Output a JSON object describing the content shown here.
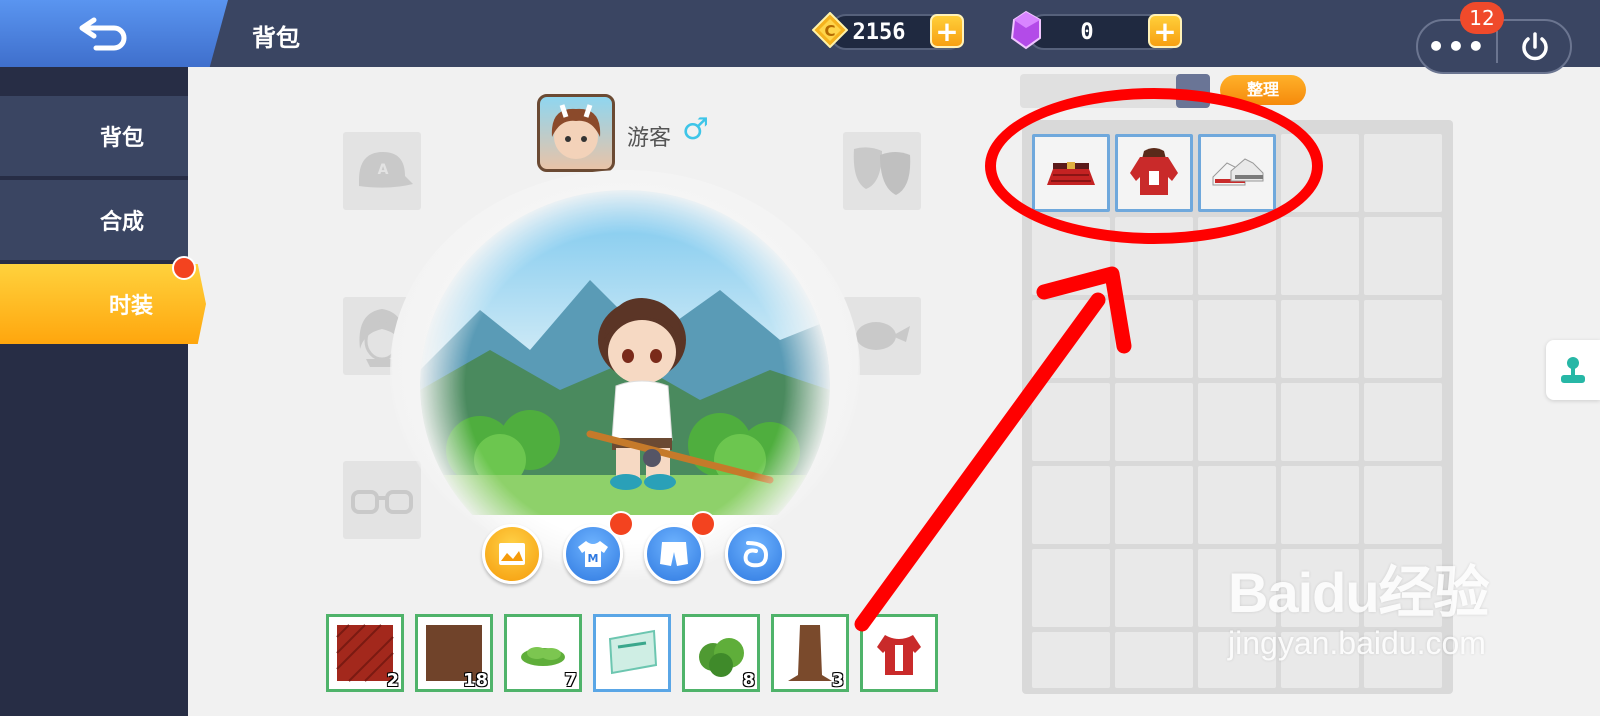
{
  "header": {
    "title": "背包",
    "coins": "2156",
    "gems": "0",
    "notification_count": "12",
    "more_label": "•••"
  },
  "sidebar": {
    "items": [
      {
        "label": "背包"
      },
      {
        "label": "合成"
      },
      {
        "label": "时装"
      }
    ]
  },
  "player": {
    "name": "游客",
    "gender_symbol": "♂"
  },
  "equip_slots": [
    "hat-slot",
    "face-slot",
    "glasses-slot",
    "mask-slot",
    "expression-slot"
  ],
  "wardrobe_tabs": [
    "background-tab",
    "top-tab",
    "bottom-tab",
    "effect-tab"
  ],
  "materials": [
    {
      "name": "red-block",
      "count": "2"
    },
    {
      "name": "brown-block",
      "count": "18"
    },
    {
      "name": "grass-tuft",
      "count": "7"
    },
    {
      "name": "banner-item",
      "count": ""
    },
    {
      "name": "leaf-bush",
      "count": "8"
    },
    {
      "name": "tree-trunk",
      "count": "3"
    },
    {
      "name": "red-jacket",
      "count": ""
    }
  ],
  "bag": {
    "sort_label": "整理",
    "items": [
      "red-skirt",
      "red-hooded-jacket",
      "red-sneakers"
    ]
  },
  "watermark": {
    "logo": "Baidu经验",
    "url": "jingyan.baidu.com"
  },
  "colors": {
    "topbar": "#3a4562",
    "sidebar": "#272d45",
    "active_tab": "#ffb81c",
    "annotation": "#ff0000"
  }
}
